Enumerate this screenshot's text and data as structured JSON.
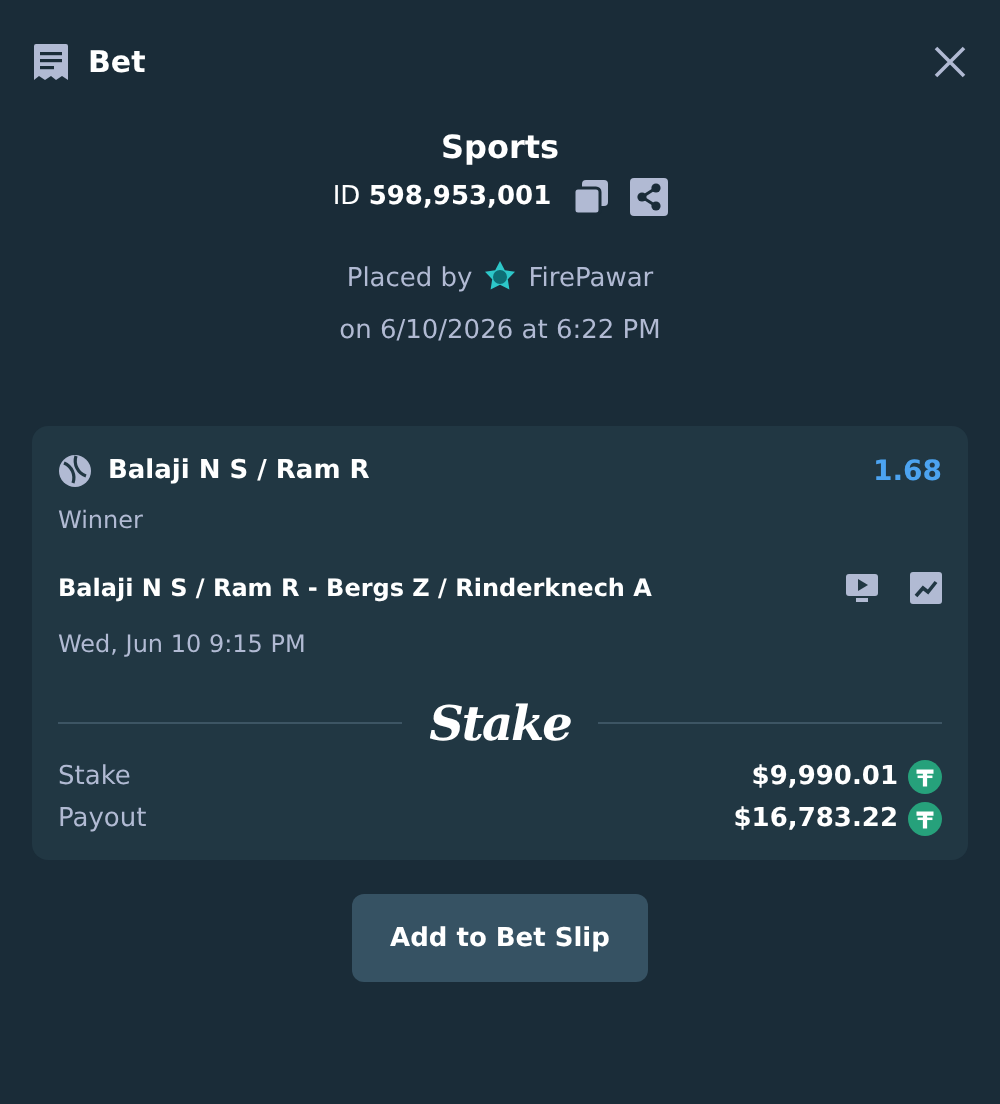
{
  "header": {
    "title": "Bet"
  },
  "summary": {
    "category": "Sports",
    "id_label": "ID",
    "id_value": "598,953,001",
    "placed_by_label": "Placed by",
    "user": "FirePawar",
    "placed_on": "on 6/10/2026 at 6:22 PM"
  },
  "selection": {
    "name": "Balaji N S / Ram R",
    "odds": "1.68",
    "market": "Winner",
    "event": "Balaji N S / Ram R - Bergs Z / Rinderknech A",
    "event_time": "Wed, Jun 10  9:15 PM"
  },
  "logo": "Stake",
  "amounts": [
    {
      "label": "Stake",
      "value": "$9,990.01"
    },
    {
      "label": "Payout",
      "value": "$16,783.22"
    }
  ],
  "button": "Add to Bet Slip"
}
